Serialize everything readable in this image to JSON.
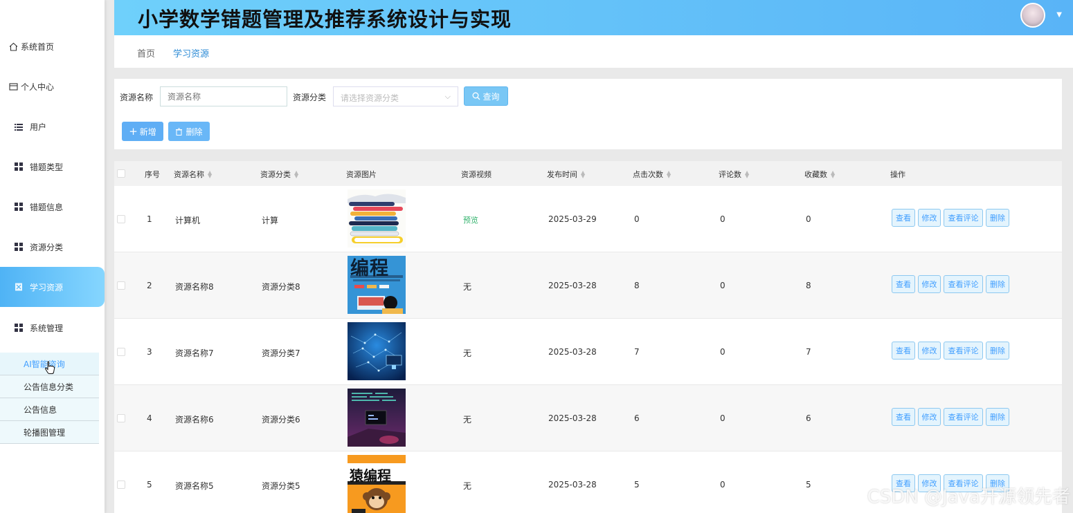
{
  "header": {
    "title": "小学数学错题管理及推荐系统设计与实现"
  },
  "sidebar": {
    "items": [
      {
        "label": "系统首页",
        "icon": "home-icon"
      },
      {
        "label": "个人中心",
        "icon": "card-icon"
      },
      {
        "label": "用户",
        "icon": "list-icon"
      },
      {
        "label": "错题类型",
        "icon": "grid-icon"
      },
      {
        "label": "错题信息",
        "icon": "grid-icon"
      },
      {
        "label": "资源分类",
        "icon": "grid-icon"
      },
      {
        "label": "学习资源",
        "icon": "book-icon",
        "active": true
      },
      {
        "label": "系统管理",
        "icon": "grid-icon"
      }
    ],
    "sub_items": [
      {
        "label": "AI智能咨询"
      },
      {
        "label": "公告信息分类"
      },
      {
        "label": "公告信息"
      },
      {
        "label": "轮播图管理"
      }
    ]
  },
  "tabs": [
    {
      "label": "首页"
    },
    {
      "label": "学习资源"
    }
  ],
  "search": {
    "name_label": "资源名称",
    "name_placeholder": "资源名称",
    "category_label": "资源分类",
    "category_placeholder": "请选择资源分类",
    "query_button": "查询",
    "add_button": "新增",
    "delete_button": "删除"
  },
  "table": {
    "headers": [
      "序号",
      "资源名称",
      "资源分类",
      "资源图片",
      "资源视频",
      "发布时间",
      "点击次数",
      "评论数",
      "收藏数",
      "操作"
    ],
    "actions": [
      "查看",
      "修改",
      "查看评论",
      "删除"
    ],
    "rows": [
      {
        "index": "1",
        "name": "计算机",
        "category": "计算",
        "video": "预览",
        "date": "2025-03-29",
        "clicks": "0",
        "comments": "0",
        "favorites": "0"
      },
      {
        "index": "2",
        "name": "资源名称8",
        "category": "资源分类8",
        "video": "无",
        "date": "2025-03-28",
        "clicks": "8",
        "comments": "0",
        "favorites": "8"
      },
      {
        "index": "3",
        "name": "资源名称7",
        "category": "资源分类7",
        "video": "无",
        "date": "2025-03-28",
        "clicks": "7",
        "comments": "0",
        "favorites": "7"
      },
      {
        "index": "4",
        "name": "资源名称6",
        "category": "资源分类6",
        "video": "无",
        "date": "2025-03-28",
        "clicks": "6",
        "comments": "0",
        "favorites": "6"
      },
      {
        "index": "5",
        "name": "资源名称5",
        "category": "资源分类5",
        "video": "无",
        "date": "2025-03-28",
        "clicks": "5",
        "comments": "0",
        "favorites": "5"
      }
    ]
  },
  "thumb_texts": {
    "row2": "编程",
    "row5": "猿编程"
  },
  "watermark": "CSDN @Java开源领先者",
  "colors": {
    "accent": "#409eff",
    "header_from": "#6fd0fb",
    "header_to": "#59b4f7",
    "preview_green": "#34b36e"
  }
}
